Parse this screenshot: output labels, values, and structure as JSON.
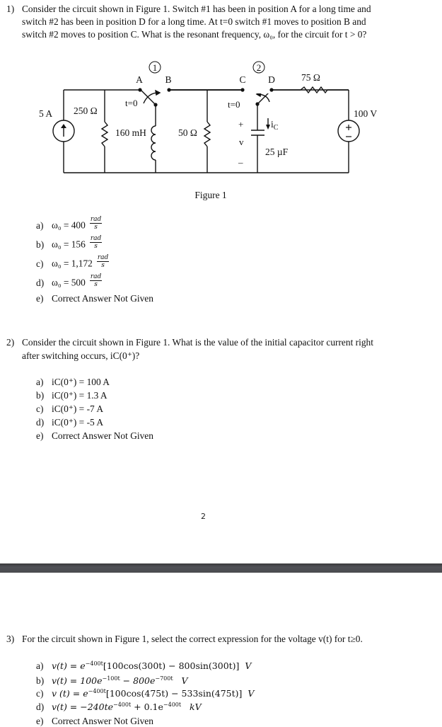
{
  "document": {
    "page_number": "2",
    "questions": [
      {
        "number": "1)",
        "lines": [
          "Consider the circuit shown in Figure 1. Switch #1 has been in position A for a long time and",
          "switch #2 has been in position D for a long time. At t=0 switch #1 moves to position B and",
          "switch #2 moves to position C. What is the resonant frequency, ω₀, for the circuit for t > 0?"
        ],
        "options": [
          {
            "label": "a)",
            "text": "ω₀ = 400",
            "unit_num": "rad",
            "unit_den": "s"
          },
          {
            "label": "b)",
            "text": "ω₀ = 156",
            "unit_num": "rad",
            "unit_den": "s"
          },
          {
            "label": "c)",
            "text": "ω₀ = 1,172",
            "unit_num": "rad",
            "unit_den": "s"
          },
          {
            "label": "d)",
            "text": "ω₀ = 500",
            "unit_num": "rad",
            "unit_den": "s"
          },
          {
            "label": "e)",
            "text": "Correct Answer Not Given"
          }
        ]
      },
      {
        "number": "2)",
        "lines": [
          "Consider the circuit shown in Figure 1. What is the value of the initial capacitor current right",
          "after switching occurs, iC(0⁺)?"
        ],
        "options": [
          {
            "label": "a)",
            "text": "iC(0⁺) = 100 A"
          },
          {
            "label": "b)",
            "text": "iC(0⁺) = 1.3 A"
          },
          {
            "label": "c)",
            "text": "iC(0⁺) = -7 A"
          },
          {
            "label": "d)",
            "text": "iC(0⁺) = -5 A"
          },
          {
            "label": "e)",
            "text": "Correct Answer Not Given"
          }
        ]
      },
      {
        "number": "3)",
        "lines": [
          "For the circuit shown in Figure 1, select the correct expression for the voltage v(t) for t≥0."
        ],
        "options": [
          {
            "label": "a)",
            "text": "v(t) = e^(−400t)[100cos(300t) − 800sin(300t)]  V"
          },
          {
            "label": "b)",
            "text": "v(t) = 100e^(−100t) − 800e^(−700t)  V"
          },
          {
            "label": "c)",
            "text": "v (t) = e^(−400t)[100cos(475t) − 533sin(475t)]  V"
          },
          {
            "label": "d)",
            "text": "v(t) = −240te^(−400t) + 0.1e^(−400t)  kV"
          },
          {
            "label": "e)",
            "text": "Correct Answer Not Given"
          }
        ]
      }
    ],
    "figure": {
      "caption": "Figure 1",
      "labels": {
        "switch1": "1",
        "switch2": "2",
        "pos_a": "A",
        "pos_b": "B",
        "pos_c": "C",
        "pos_d": "D",
        "t0_1": "t=0",
        "t0_2": "t=0",
        "source_current": "5 A",
        "r1": "250 Ω",
        "inductor": "160 mH",
        "r2": "50 Ω",
        "r3": "75 Ω",
        "source_voltage": "100 V",
        "capacitor": "25 µF",
        "cap_current": "i",
        "cap_current_sub": "C",
        "v_plus": "+",
        "v_label": "v",
        "v_minus": "–"
      }
    },
    "math": {
      "q3": {
        "a": {
          "pre": "v(t) = ",
          "exp": "−400t",
          "post": "[100cos(300t) − 800sin(300t)]",
          "unit": "V"
        },
        "b": {
          "pre": "v(t) = 100e",
          "exp1": "−100t",
          "mid": " − 800e",
          "exp2": "−700t",
          "unit": "V"
        },
        "c": {
          "pre": "v (t) = ",
          "exp": "−400t",
          "post": "[100cos(475t) − 533sin(475t)]",
          "unit": "V"
        },
        "d": {
          "pre": "v(t) = −240te",
          "exp1": "−400t",
          "mid": " + 0.1e",
          "exp2": "−400t",
          "unit": "kV"
        }
      }
    }
  }
}
